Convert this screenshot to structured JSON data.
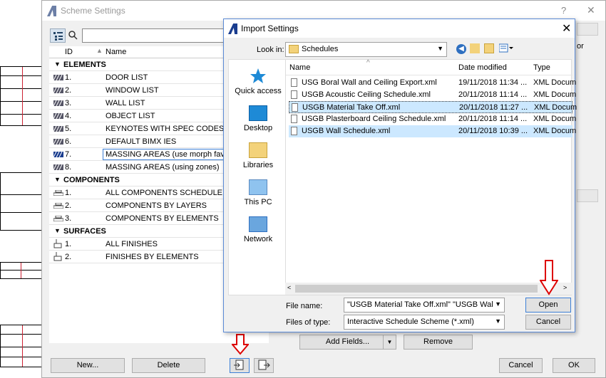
{
  "scheme_window": {
    "title": "Scheme Settings",
    "help": "?",
    "close": "✕",
    "list_header": {
      "id": "ID",
      "name": "Name"
    },
    "groups": [
      {
        "label": "ELEMENTS",
        "items": [
          {
            "id": "1.",
            "name": "DOOR LIST"
          },
          {
            "id": "2.",
            "name": "WINDOW LIST"
          },
          {
            "id": "3.",
            "name": "WALL LIST"
          },
          {
            "id": "4.",
            "name": "OBJECT LIST"
          },
          {
            "id": "5.",
            "name": "KEYNOTES WITH SPEC CODES"
          },
          {
            "id": "6.",
            "name": "DEFAULT BIMX IES"
          },
          {
            "id": "7.",
            "name": "MASSING AREAS (use morph favourites)"
          },
          {
            "id": "8.",
            "name": "MASSING AREAS (using zones)"
          }
        ]
      },
      {
        "label": "COMPONENTS",
        "items": [
          {
            "id": "1.",
            "name": "ALL COMPONENTS SCHEDULE"
          },
          {
            "id": "2.",
            "name": "COMPONENTS BY LAYERS"
          },
          {
            "id": "3.",
            "name": "COMPONENTS BY ELEMENTS"
          }
        ]
      },
      {
        "label": "SURFACES",
        "items": [
          {
            "id": "1.",
            "name": "ALL FINISHES"
          },
          {
            "id": "2.",
            "name": "FINISHES BY ELEMENTS"
          }
        ]
      }
    ],
    "new_label": "New...",
    "delete_label": "Delete",
    "add_fields_label": "Add Fields...",
    "remove_label": "Remove",
    "cancel_label": "Cancel",
    "ok_label": "OK",
    "right_fragment": "or"
  },
  "import_dialog": {
    "title": "Import Settings",
    "look_in_label": "Look in:",
    "look_in_value": "Schedules",
    "places": [
      "Quick access",
      "Desktop",
      "Libraries",
      "This PC",
      "Network"
    ],
    "columns": {
      "name": "Name",
      "date": "Date modified",
      "type": "Type"
    },
    "files": [
      {
        "name": "USG Boral Wall and Ceiling Export.xml",
        "date": "19/11/2018 11:34 ...",
        "type": "XML Docum"
      },
      {
        "name": "USGB Acoustic Ceiling Schedule.xml",
        "date": "20/11/2018 11:14 ...",
        "type": "XML Docum"
      },
      {
        "name": "USGB Material Take Off.xml",
        "date": "20/11/2018 11:27 ...",
        "type": "XML Docum"
      },
      {
        "name": "USGB Plasterboard Ceiling Schedule.xml",
        "date": "20/11/2018 11:14 ...",
        "type": "XML Docum"
      },
      {
        "name": "USGB Wall Schedule.xml",
        "date": "20/11/2018 10:39 ...",
        "type": "XML Docum"
      }
    ],
    "file_name_label": "File name:",
    "file_name_value": "\"USGB Material Take Off.xml\" \"USGB Wall Sche",
    "file_type_label": "Files of type:",
    "file_type_value": "Interactive Schedule Scheme (*.xml)",
    "open_label": "Open",
    "cancel_label": "Cancel"
  }
}
